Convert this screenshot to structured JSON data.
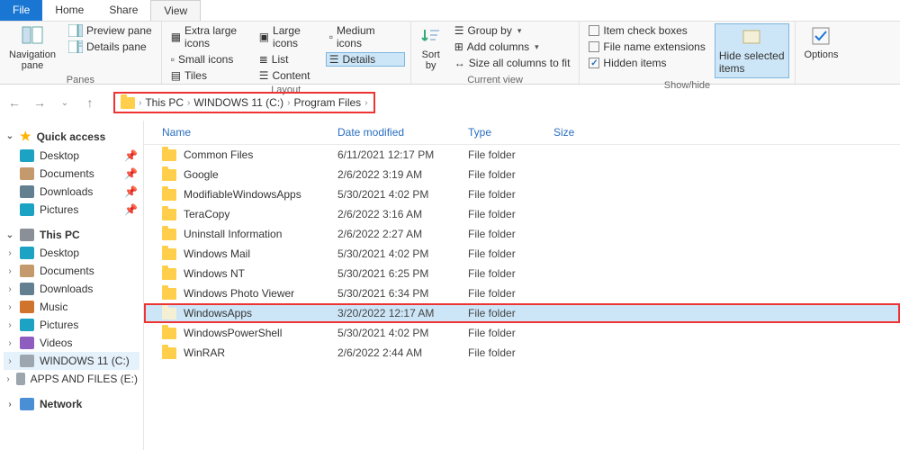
{
  "tabs": {
    "file": "File",
    "home": "Home",
    "share": "Share",
    "view": "View"
  },
  "ribbon": {
    "panes": {
      "title": "Panes",
      "navpane": "Navigation\npane",
      "preview": "Preview pane",
      "details": "Details pane"
    },
    "layout": {
      "title": "Layout",
      "xl": "Extra large icons",
      "lg": "Large icons",
      "md": "Medium icons",
      "sm": "Small icons",
      "list": "List",
      "details": "Details",
      "tiles": "Tiles",
      "content": "Content"
    },
    "current": {
      "title": "Current view",
      "sort": "Sort\nby",
      "group": "Group by",
      "addcols": "Add columns",
      "sizecols": "Size all columns to fit"
    },
    "showhide": {
      "title": "Show/hide",
      "itemchk": "Item check boxes",
      "fext": "File name extensions",
      "hidden": "Hidden items",
      "hidesel": "Hide selected\nitems"
    },
    "options": "Options"
  },
  "breadcrumb": [
    "This PC",
    "WINDOWS 11 (C:)",
    "Program Files"
  ],
  "tree": {
    "quick": "Quick access",
    "quick_items": [
      {
        "label": "Desktop",
        "ic": "ic-desk",
        "pin": true
      },
      {
        "label": "Documents",
        "ic": "ic-doc",
        "pin": true
      },
      {
        "label": "Downloads",
        "ic": "ic-down",
        "pin": true
      },
      {
        "label": "Pictures",
        "ic": "ic-pic",
        "pin": true
      }
    ],
    "thispc": "This PC",
    "pc_items": [
      {
        "label": "Desktop",
        "ic": "ic-desk"
      },
      {
        "label": "Documents",
        "ic": "ic-doc"
      },
      {
        "label": "Downloads",
        "ic": "ic-down"
      },
      {
        "label": "Music",
        "ic": "ic-music"
      },
      {
        "label": "Pictures",
        "ic": "ic-pic"
      },
      {
        "label": "Videos",
        "ic": "ic-vid"
      },
      {
        "label": "WINDOWS 11 (C:)",
        "ic": "ic-drv",
        "sel": true
      },
      {
        "label": "APPS AND FILES (E:)",
        "ic": "ic-drv"
      }
    ],
    "network": "Network"
  },
  "columns": {
    "name": "Name",
    "date": "Date modified",
    "type": "Type",
    "size": "Size"
  },
  "files": [
    {
      "name": "Common Files",
      "date": "6/11/2021 12:17 PM",
      "type": "File folder"
    },
    {
      "name": "Google",
      "date": "2/6/2022 3:19 AM",
      "type": "File folder"
    },
    {
      "name": "ModifiableWindowsApps",
      "date": "5/30/2021 4:02 PM",
      "type": "File folder"
    },
    {
      "name": "TeraCopy",
      "date": "2/6/2022 3:16 AM",
      "type": "File folder"
    },
    {
      "name": "Uninstall Information",
      "date": "2/6/2022 2:27 AM",
      "type": "File folder"
    },
    {
      "name": "Windows Mail",
      "date": "5/30/2021 4:02 PM",
      "type": "File folder"
    },
    {
      "name": "Windows NT",
      "date": "5/30/2021 6:25 PM",
      "type": "File folder"
    },
    {
      "name": "Windows Photo Viewer",
      "date": "5/30/2021 6:34 PM",
      "type": "File folder"
    },
    {
      "name": "WindowsApps",
      "date": "3/20/2022 12:17 AM",
      "type": "File folder",
      "highlight": true,
      "dim": true
    },
    {
      "name": "WindowsPowerShell",
      "date": "5/30/2021 4:02 PM",
      "type": "File folder"
    },
    {
      "name": "WinRAR",
      "date": "2/6/2022 2:44 AM",
      "type": "File folder"
    }
  ]
}
